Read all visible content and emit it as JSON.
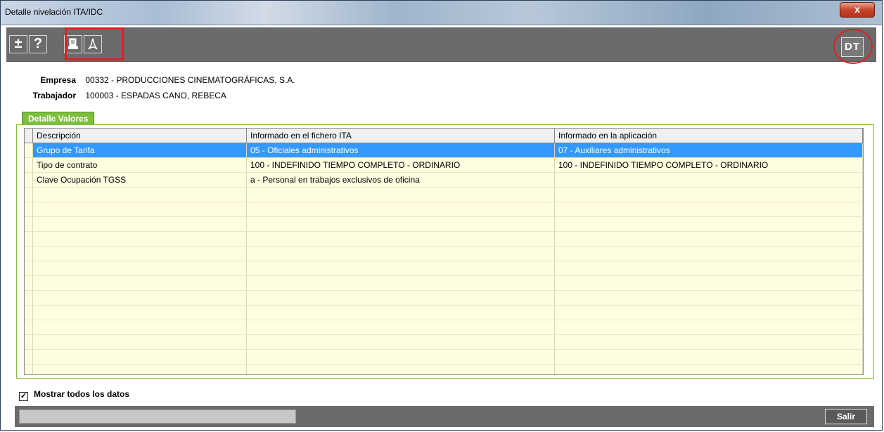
{
  "window": {
    "title": "Detalle nivelación ITA/IDC",
    "close_label": "x"
  },
  "toolbar": {
    "expand_label": "±",
    "help_label": "?",
    "dt_label": "DT"
  },
  "info": {
    "empresa_label": "Empresa",
    "empresa_value": "00332 - PRODUCCIONES CINEMATOGRÁFICAS, S.A.",
    "trabajador_label": "Trabajador",
    "trabajador_value": "100003 - ESPADAS CANO, REBECA"
  },
  "tab": {
    "label": "Detalle Valores"
  },
  "table": {
    "columns": [
      "Descripción",
      "Informado en el fichero ITA",
      "Informado en la aplicación"
    ],
    "rows": [
      [
        "Grupo de Tarifa",
        "05 - Oficiales administrativos",
        "07 - Auxiliares administrativos"
      ],
      [
        "Tipo de contrato",
        "100 - INDEFINIDO TIEMPO COMPLETO - ORDINARIO",
        "100 - INDEFINIDO TIEMPO COMPLETO - ORDINARIO"
      ],
      [
        "Clave Ocupación TGSS",
        "a - Personal en trabajos exclusivos de oficina",
        ""
      ]
    ],
    "selected_row": 0
  },
  "footer": {
    "show_all_label": "Mostrar todos los datos",
    "show_all_checked": true,
    "exit_label": "Salir"
  },
  "icons": {
    "expand": "plus-minus-icon",
    "help": "question-icon",
    "print": "printer-icon",
    "pdf": "pdf-icon"
  },
  "colors": {
    "tab": "#7fbf3f",
    "selection": "#3399ff",
    "grid_bg": "#fffde0",
    "highlight": "#e02020"
  }
}
